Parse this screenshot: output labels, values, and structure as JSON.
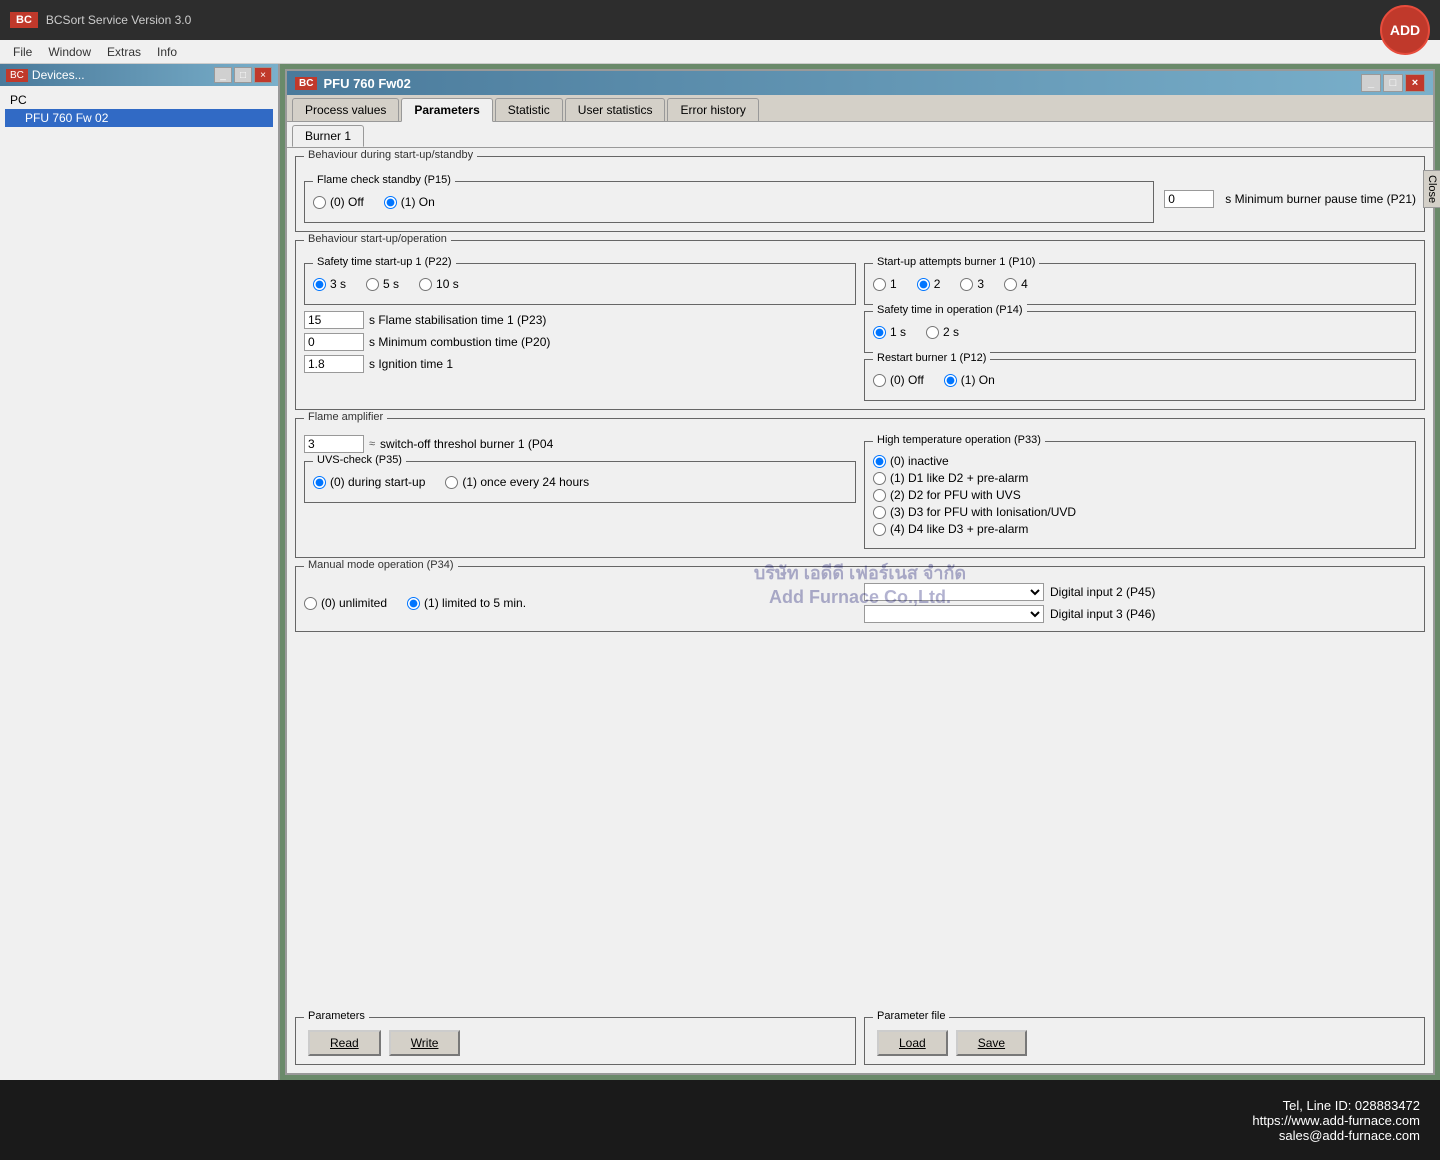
{
  "app": {
    "title": "BCSort Service Version 3.0",
    "logo": "BC"
  },
  "add_logo": "ADD",
  "menu": {
    "items": [
      "File",
      "Window",
      "Extras",
      "Info"
    ]
  },
  "devices_panel": {
    "title": "Devices...",
    "tree": [
      {
        "label": "PC",
        "indent": false
      },
      {
        "label": "PFU 760 Fw 02",
        "indent": true
      }
    ]
  },
  "pfu_window": {
    "title": "PFU 760 Fw02",
    "tabs": [
      {
        "label": "Process values",
        "active": false
      },
      {
        "label": "Parameters",
        "active": true
      },
      {
        "label": "Statistic",
        "active": false
      },
      {
        "label": "User statistics",
        "active": false
      },
      {
        "label": "Error history",
        "active": false
      }
    ],
    "sub_tabs": [
      {
        "label": "Burner 1",
        "active": true
      }
    ]
  },
  "behaviour_startup_standby": {
    "title": "Behaviour during start-up/standby",
    "flame_check": {
      "title": "Flame check standby (P15)",
      "options": [
        {
          "label": "(0) Off",
          "value": "off",
          "selected": false
        },
        {
          "label": "(1) On",
          "value": "on",
          "selected": true
        }
      ]
    },
    "min_pause_time": {
      "value": "0",
      "label": "s Minimum burner pause time (P21)"
    }
  },
  "behaviour_startup_operation": {
    "title": "Behaviour start-up/operation",
    "safety_time": {
      "title": "Safety time start-up 1 (P22)",
      "options": [
        {
          "label": "3 s",
          "selected": true
        },
        {
          "label": "5 s",
          "selected": false
        },
        {
          "label": "10 s",
          "selected": false
        }
      ]
    },
    "startup_attempts": {
      "title": "Start-up attempts burner 1 (P10)",
      "options": [
        {
          "label": "1",
          "selected": false
        },
        {
          "label": "2",
          "selected": true
        },
        {
          "label": "3",
          "selected": false
        },
        {
          "label": "4",
          "selected": false
        }
      ]
    },
    "flame_stabilisation": {
      "value": "15",
      "label": "s Flame stabilisation time 1 (P23)"
    },
    "min_combustion": {
      "value": "0",
      "label": "s Minimum combustion time (P20)"
    },
    "ignition_time": {
      "value": "1.8",
      "label": "s Ignition time 1"
    },
    "safety_operation": {
      "title": "Safety time in operation (P14)",
      "options": [
        {
          "label": "1 s",
          "selected": true
        },
        {
          "label": "2 s",
          "selected": false
        }
      ]
    },
    "restart_burner": {
      "title": "Restart burner 1 (P12)",
      "options": [
        {
          "label": "(0) Off",
          "selected": false
        },
        {
          "label": "(1) On",
          "selected": true
        }
      ]
    }
  },
  "flame_amplifier": {
    "title": "Flame amplifier",
    "switch_off": {
      "value": "3",
      "label": "switch-off threshol burner 1 (P04"
    },
    "uvs_check": {
      "title": "UVS-check (P35)",
      "options": [
        {
          "label": "(0) during start-up",
          "selected": true
        },
        {
          "label": "(1) once every 24 hours",
          "selected": false
        }
      ]
    },
    "high_temp": {
      "title": "High temperature operation (P33)",
      "options": [
        {
          "label": "(0) inactive",
          "selected": true
        },
        {
          "label": "(1) D1 like D2 + pre-alarm",
          "selected": false
        },
        {
          "label": "(2) D2 for PFU with UVS",
          "selected": false
        },
        {
          "label": "(3) D3 for PFU with Ionisation/UVD",
          "selected": false
        },
        {
          "label": "(4) D4 like D3 + pre-alarm",
          "selected": false
        }
      ]
    }
  },
  "manual_mode": {
    "title": "Manual mode operation (P34)",
    "options": [
      {
        "label": "(0) unlimited",
        "selected": false
      },
      {
        "label": "(1) limited to 5 min.",
        "selected": true
      }
    ],
    "digital_input2_label": "Digital input 2 (P45)",
    "digital_input3_label": "Digital input 3 (P46)"
  },
  "parameters": {
    "title": "Parameters",
    "read_label": "Read",
    "write_label": "Write"
  },
  "parameter_file": {
    "title": "Parameter file",
    "load_label": "Load",
    "save_label": "Save"
  },
  "watermark": {
    "line1": "บริษัท เอดีดี เฟอร์เนส จำกัด",
    "line2": "Add Furnace Co.,Ltd."
  },
  "footer": {
    "tel": "Tel, Line ID: 028883472",
    "website": "https://www.add-furnace.com",
    "email": "sales@add-furnace.com"
  },
  "close_btn": "Close"
}
